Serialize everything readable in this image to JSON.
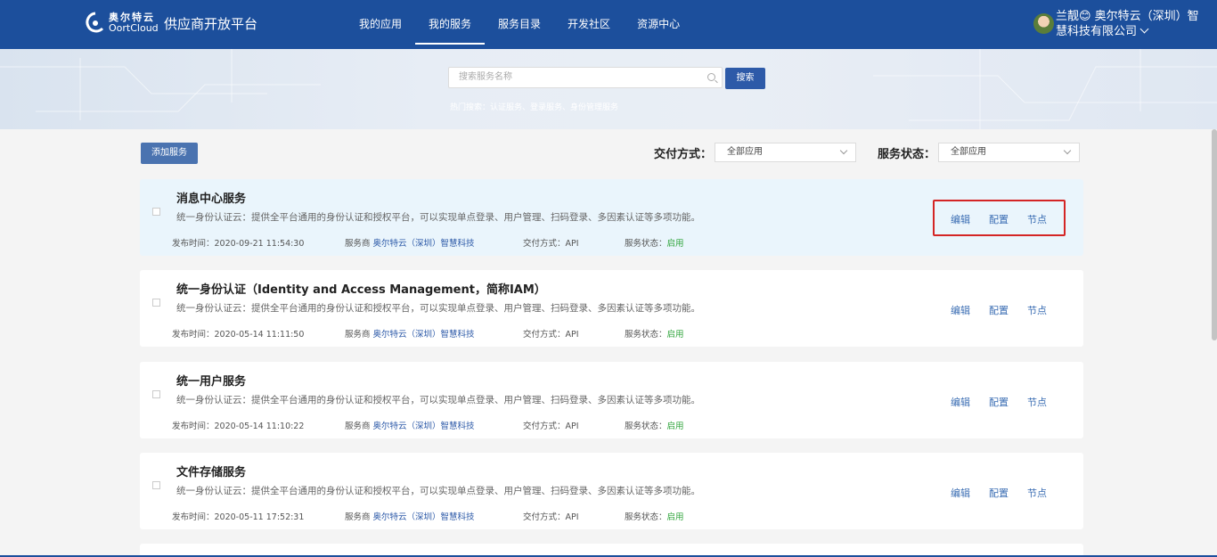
{
  "header": {
    "logo_cn": "奥尔特云",
    "logo_en": "OortCloud",
    "platform_title": "供应商开放平台",
    "nav": [
      {
        "label": "我的应用",
        "active": false
      },
      {
        "label": "我的服务",
        "active": true
      },
      {
        "label": "服务目录",
        "active": false
      },
      {
        "label": "开发社区",
        "active": false
      },
      {
        "label": "资源中心",
        "active": false
      }
    ],
    "user_name": "兰靓😊 奥尔特云（深圳）智慧科技有限公司"
  },
  "search": {
    "placeholder": "搜索服务名称",
    "button_label": "搜索",
    "hot": "热门搜索：认证服务、登录服务、身份管理服务"
  },
  "toolbar": {
    "add_label": "添加服务",
    "delivery_label": "交付方式：",
    "delivery_value": "全部应用",
    "status_label": "服务状态：",
    "status_value": "全部应用"
  },
  "services": [
    {
      "title": "消息中心服务",
      "desc": "统一身份认证云：提供全平台通用的身份认证和授权平台，可以实现单点登录、用户管理、扫码登录、多因素认证等多项功能。",
      "publish": "发布时间：2020-09-21 11:54:30",
      "provider_label": "服务商",
      "provider": "奥尔特云（深圳）智慧科技",
      "delivery": "交付方式：API",
      "status_label": "服务状态：",
      "status": "启用",
      "highlight": true
    },
    {
      "title": "统一身份认证（Identity and Access Management，简称IAM）",
      "desc": "统一身份认证云：提供全平台通用的身份认证和授权平台，可以实现单点登录、用户管理、扫码登录、多因素认证等多项功能。",
      "publish": "发布时间：2020-05-14 11:11:50",
      "provider_label": "服务商",
      "provider": "奥尔特云（深圳）智慧科技",
      "delivery": "交付方式：API",
      "status_label": "服务状态：",
      "status": "启用",
      "highlight": false
    },
    {
      "title": "统一用户服务",
      "desc": "统一身份认证云：提供全平台通用的身份认证和授权平台，可以实现单点登录、用户管理、扫码登录、多因素认证等多项功能。",
      "publish": "发布时间：2020-05-14 11:10:22",
      "provider_label": "服务商",
      "provider": "奥尔特云（深圳）智慧科技",
      "delivery": "交付方式：API",
      "status_label": "服务状态：",
      "status": "启用",
      "highlight": false
    },
    {
      "title": "文件存储服务",
      "desc": "统一身份认证云：提供全平台通用的身份认证和授权平台，可以实现单点登录、用户管理、扫码登录、多因素认证等多项功能。",
      "publish": "发布时间：2020-05-11 17:52:31",
      "provider_label": "服务商",
      "provider": "奥尔特云（深圳）智慧科技",
      "delivery": "交付方式：API",
      "status_label": "服务状态：",
      "status": "启用",
      "highlight": false
    }
  ],
  "actions": {
    "edit": "编辑",
    "config": "配置",
    "node": "节点"
  },
  "colors": {
    "header_bg": "#1c4f9c",
    "primary": "#2d5aa8",
    "highlight_bg": "#eaf5fc",
    "status_ok": "#2ea43a",
    "callout": "#d42525"
  }
}
